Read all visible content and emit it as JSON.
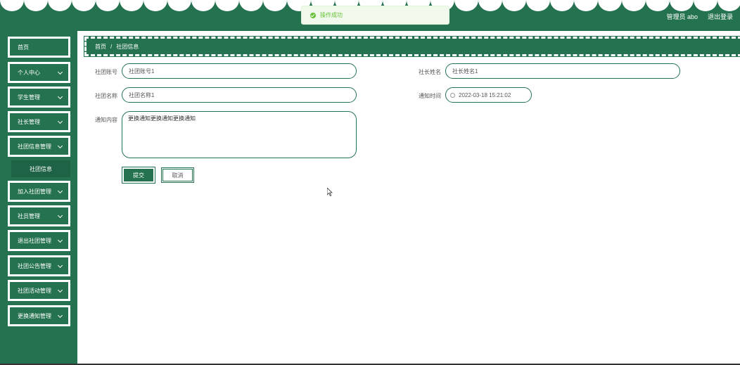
{
  "header": {
    "user_text": "管理员 abo",
    "logout_label": "退出登录"
  },
  "toast": {
    "message": "操作成功"
  },
  "sidebar": {
    "items": [
      {
        "label": "首页"
      },
      {
        "label": "个人中心"
      },
      {
        "label": "学生管理"
      },
      {
        "label": "社长管理"
      },
      {
        "label": "社团信息管理"
      },
      {
        "label": "加入社团管理"
      },
      {
        "label": "社员管理"
      },
      {
        "label": "退出社团管理"
      },
      {
        "label": "社团公告管理"
      },
      {
        "label": "社团活动管理"
      },
      {
        "label": "更换通知管理"
      }
    ],
    "sub_item": "社团信息"
  },
  "breadcrumb": {
    "home": "首页",
    "separator": "/",
    "current": "社团信息"
  },
  "form": {
    "club_account_label": "社团账号",
    "club_account_value": "社团账号1",
    "president_name_label": "社长姓名",
    "president_name_value": "社长姓名1",
    "club_name_label": "社团名称",
    "club_name_value": "社团名称1",
    "notice_time_label": "通知时间",
    "notice_time_value": "2022-03-18 15:21:02",
    "notice_content_label": "通知内容",
    "notice_content_value": "更换通知更换通知更换通知",
    "submit_label": "提交",
    "cancel_label": "取消"
  },
  "colors": {
    "primary": "#257250",
    "success": "#67c23a"
  }
}
